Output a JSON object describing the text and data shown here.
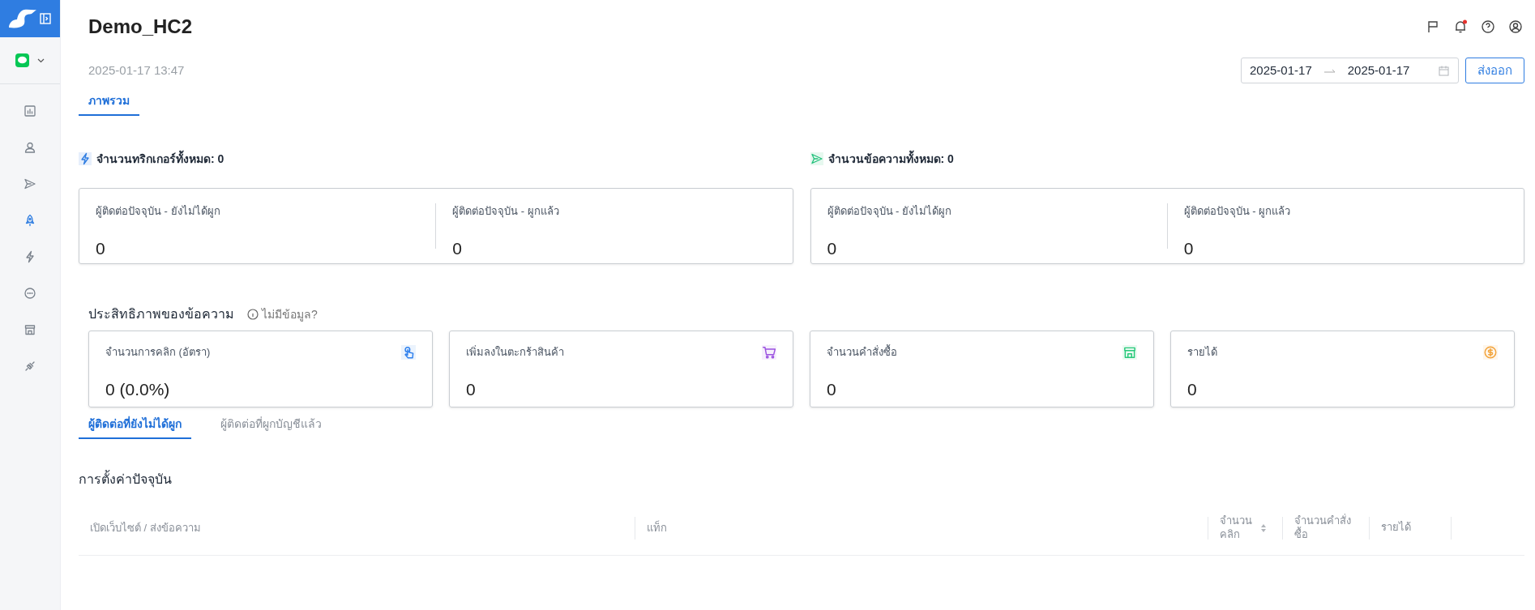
{
  "sidebar": {
    "items": [
      {
        "selected": false
      },
      {
        "selected": false
      },
      {
        "selected": false
      },
      {
        "selected": true
      },
      {
        "selected": false
      },
      {
        "selected": false
      },
      {
        "selected": false
      },
      {
        "selected": false
      }
    ]
  },
  "header": {
    "title": "Demo_HC2",
    "timestamp": "2025-01-17 13:47",
    "notification_unread": true
  },
  "date_range": {
    "start": "2025-01-17",
    "end": "2025-01-17"
  },
  "export_button": "ส่งออก",
  "tabs": [
    {
      "label": "ภาพรวม",
      "selected": true
    }
  ],
  "summaries": [
    {
      "title": "จำนวนทริกเกอร์ทั้งหมด: 0",
      "stats": [
        {
          "label": "ผู้ติดต่อปัจจุบัน - ยังไม่ได้ผูก",
          "value": "0"
        },
        {
          "label": "ผู้ติดต่อปัจจุบัน - ผูกแล้ว",
          "value": "0"
        }
      ]
    },
    {
      "title": "จำนวนข้อความทั้งหมด: 0",
      "stats": [
        {
          "label": "ผู้ติดต่อปัจจุบัน - ยังไม่ได้ผูก",
          "value": "0"
        },
        {
          "label": "ผู้ติดต่อปัจจุบัน - ผูกแล้ว",
          "value": "0"
        }
      ]
    }
  ],
  "performance": {
    "title": "ประสิทธิภาพของข้อความ",
    "help_link": "ไม่มีข้อมูล?",
    "cards": [
      {
        "label": "จำนวนการคลิก (อัตรา)",
        "value": "0 (0.0%)",
        "color": "#2f80ed"
      },
      {
        "label": "เพิ่มลงในตะกร้าสินค้า",
        "value": "0",
        "color": "#9b51e0"
      },
      {
        "label": "จำนวนคำสั่งซื้อ",
        "value": "0",
        "color": "#27c97a"
      },
      {
        "label": "รายได้",
        "value": "0",
        "color": "#f2a33a"
      }
    ]
  },
  "contact_tabs": [
    {
      "label": "ผู้ติดต่อที่ยังไม่ได้ผูก",
      "selected": true
    },
    {
      "label": "ผู้ติดต่อที่ผูกบัญชีแล้ว",
      "selected": false
    }
  ],
  "settings_title": "การตั้งค่าปัจจุบัน",
  "table": {
    "columns": [
      {
        "label": "เปิดเว็บไซต์ / ส่งข้อความ",
        "sortable": false
      },
      {
        "label": "แท็ก",
        "sortable": false
      },
      {
        "label": "จำนวนคลิก",
        "sortable": true
      },
      {
        "label": "จำนวนคำสั่งซื้อ",
        "sortable": false
      },
      {
        "label": "รายได้",
        "sortable": false
      }
    ]
  }
}
